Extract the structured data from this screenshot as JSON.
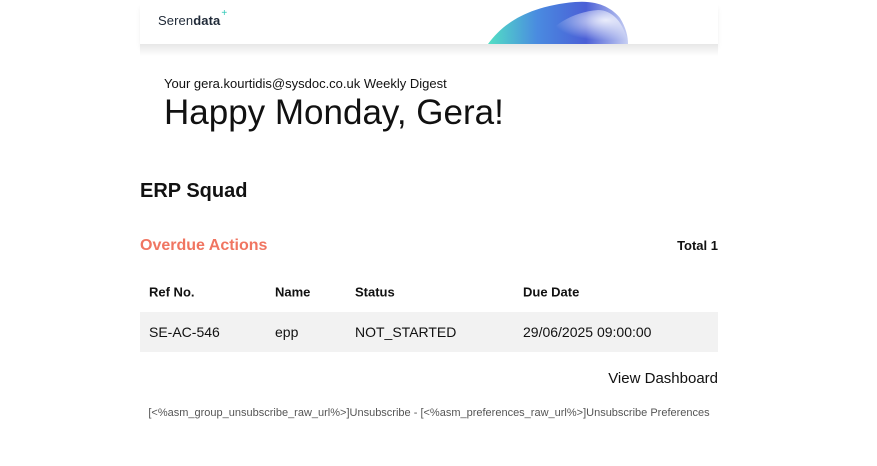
{
  "header": {
    "logo_light": "Seren",
    "logo_bold": "data",
    "logo_plus": "+"
  },
  "intro": {
    "digest": "Your gera.kourtidis@sysdoc.co.uk Weekly Digest",
    "greeting": "Happy Monday, Gera!"
  },
  "team": {
    "name": "ERP Squad"
  },
  "overdue": {
    "title": "Overdue Actions",
    "total": "Total 1"
  },
  "table": {
    "columns": [
      "Ref No.",
      "Name",
      "Status",
      "Due Date"
    ],
    "rows": [
      [
        "SE-AC-546",
        "epp",
        "NOT_STARTED",
        "29/06/2025 09:00:00"
      ]
    ]
  },
  "actions": {
    "view_dashboard": "View Dashboard"
  },
  "footer": {
    "unsubscribe": "[<%asm_group_unsubscribe_raw_url%>]Unsubscribe",
    "separator": " - ",
    "preferences": "[<%asm_preferences_raw_url%>]Unsubscribe Preferences"
  },
  "colors": {
    "accent": "#f07561",
    "row_bg": "#f2f2f2",
    "logo_plus": "#2cc7b6"
  }
}
